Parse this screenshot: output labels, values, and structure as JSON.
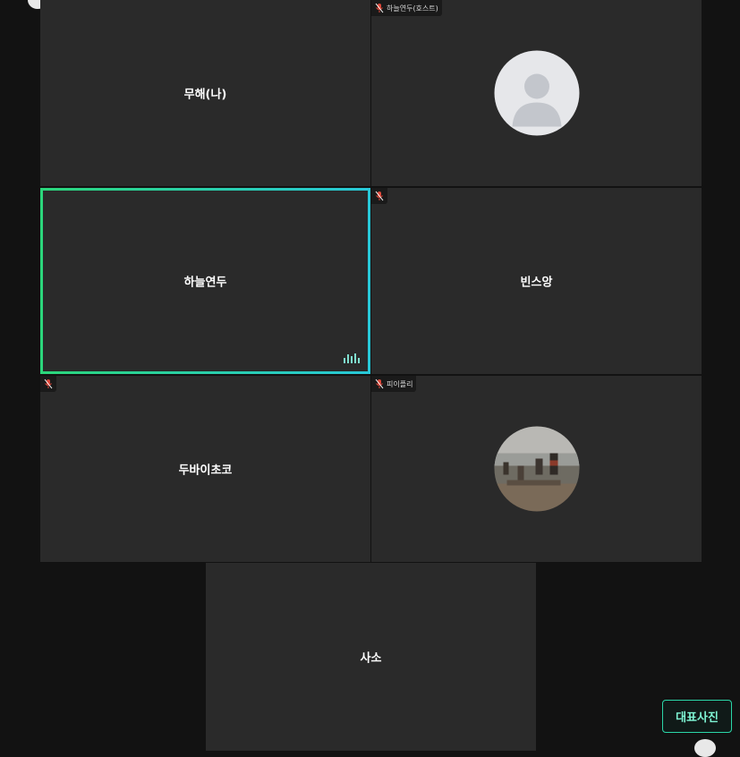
{
  "participants": [
    {
      "name": "무해(나)",
      "tag": ""
    },
    {
      "name": "",
      "tag": "하늘연두(호스트)"
    },
    {
      "name": "하늘연두",
      "tag": ""
    },
    {
      "name": "빈스앙",
      "tag": ""
    },
    {
      "name": "두바이초코",
      "tag": ""
    },
    {
      "name": "",
      "tag": "피이플리"
    },
    {
      "name": "사소",
      "tag": ""
    }
  ],
  "controls": {
    "representative_photo_label": "대표사진"
  },
  "colors": {
    "background": "#121212",
    "tile": "#2a2a2a",
    "speaking_border_start": "#2bd67b",
    "speaking_border_end": "#28c8d8",
    "muted_mic": "#e0483a"
  },
  "icons": [
    "mic-muted-icon",
    "audio-level-icon",
    "default-avatar-icon"
  ]
}
